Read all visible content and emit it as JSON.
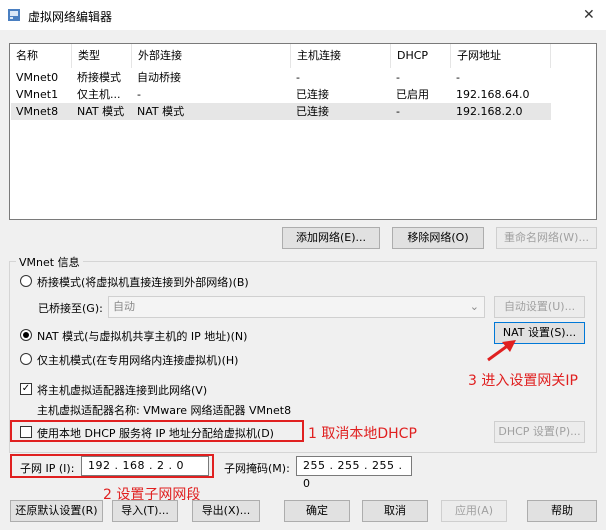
{
  "window": {
    "title": "虚拟网络编辑器",
    "close_glyph": "✕"
  },
  "table": {
    "columns": [
      "名称",
      "类型",
      "外部连接",
      "主机连接",
      "DHCP",
      "子网地址"
    ],
    "rows": [
      [
        "VMnet0",
        "桥接模式",
        "自动桥接",
        "-",
        "-",
        "-"
      ],
      [
        "VMnet1",
        "仅主机...",
        "-",
        "已连接",
        "已启用",
        "192.168.64.0"
      ],
      [
        "VMnet8",
        "NAT 模式",
        "NAT 模式",
        "已连接",
        "-",
        "192.168.2.0"
      ]
    ],
    "selected_row": 2
  },
  "list_buttons": {
    "add": "添加网络(E)...",
    "remove": "移除网络(O)",
    "rename": "重命名网络(W)..."
  },
  "vmnet_info": {
    "label": "VMnet 信息",
    "bridged_radio": "桥接模式(将虚拟机直接连接到外部网络)(B)",
    "bridged_to_label": "已桥接至(G):",
    "bridged_to_value": "自动",
    "auto_settings": "自动设置(U)...",
    "nat_radio": "NAT 模式(与虚拟机共享主机的 IP 地址)(N)",
    "nat_settings": "NAT 设置(S)...",
    "hostonly_radio": "仅主机模式(在专用网络内连接虚拟机)(H)",
    "connect_adapter": "将主机虚拟适配器连接到此网络(V)",
    "adapter_name": "主机虚拟适配器名称: VMware 网络适配器 VMnet8",
    "use_dhcp": "使用本地 DHCP 服务将 IP 地址分配给虚拟机(D)",
    "dhcp_settings": "DHCP 设置(P)...",
    "subnet_ip_label": "子网 IP (I):",
    "subnet_ip_value": "192 . 168 .  2  .  0",
    "subnet_mask_label": "子网掩码(M):",
    "subnet_mask_value": "255 . 255 . 255 .  0"
  },
  "annotations": {
    "a1": "1 取消本地DHCP",
    "a2": "2 设置子网网段",
    "a3": "3 进入设置网关IP"
  },
  "bottom_buttons": {
    "restore": "还原默认设置(R)",
    "import": "导入(T)...",
    "export": "导出(X)...",
    "ok": "确定",
    "cancel": "取消",
    "apply": "应用(A)",
    "help": "帮助"
  },
  "colors": {
    "annotation_red": "#e02020",
    "accent_blue": "#0078d7"
  }
}
